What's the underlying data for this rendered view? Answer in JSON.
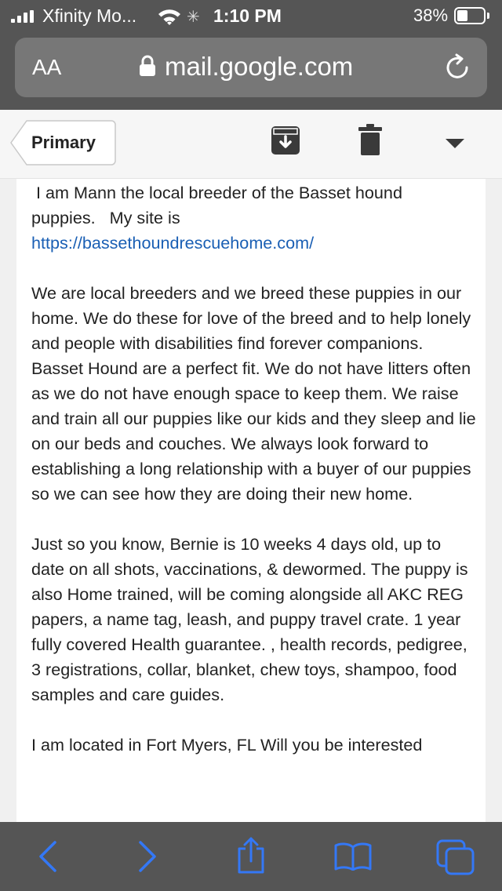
{
  "status_bar": {
    "carrier": "Xfinity Mo...",
    "time": "1:10 PM",
    "battery_percent": "38%",
    "battery_level": 0.38,
    "icons": [
      "signal-icon",
      "wifi-icon",
      "activity-spinner-icon",
      "battery-icon"
    ]
  },
  "browser": {
    "text_size_label": "AA",
    "url": "mail.google.com",
    "icons": [
      "lock-icon",
      "reload-icon"
    ]
  },
  "gmail_toolbar": {
    "back_label": "Primary",
    "icons": [
      "archive-icon",
      "trash-icon",
      "more-icon"
    ]
  },
  "email": {
    "intro_line1": "I am Mann the local breeder of the Basset hound",
    "intro_line2": "puppies.   My site is",
    "link": "https://bassethoundrescuehome.com/",
    "paragraph2": "We are local breeders and we breed these puppies in our home. We do these for love of the breed and to help lonely and people with disabilities find forever companions. Basset Hound are a perfect fit. We do not have litters often as we do not have enough space to keep them. We raise and train all our puppies like our kids and they sleep and lie on our beds and couches. We always look forward to establishing a long relationship with a buyer of our puppies so we can see how they are doing their new home.",
    "paragraph3": "Just so you know, Bernie is 10 weeks 4 days old, up to date on all shots, vaccinations, & dewormed. The puppy is also Home trained, will be coming alongside all AKC REG papers, a name tag, leash, and puppy travel crate. 1 year fully covered Health guarantee. , health records, pedigree, 3 registrations, collar, blanket, chew toys, shampoo, food samples and care guides.",
    "paragraph4_partial": "I am located in Fort Myers, FL Will you be interested"
  },
  "bottom_bar": {
    "icons": [
      "back-arrow-icon",
      "forward-arrow-icon",
      "share-icon",
      "bookmarks-icon",
      "tabs-icon"
    ]
  },
  "colors": {
    "chrome_gray": "#555555",
    "url_field": "#777777",
    "link_blue": "#1a5fb4",
    "ios_blue": "#3478f6"
  }
}
